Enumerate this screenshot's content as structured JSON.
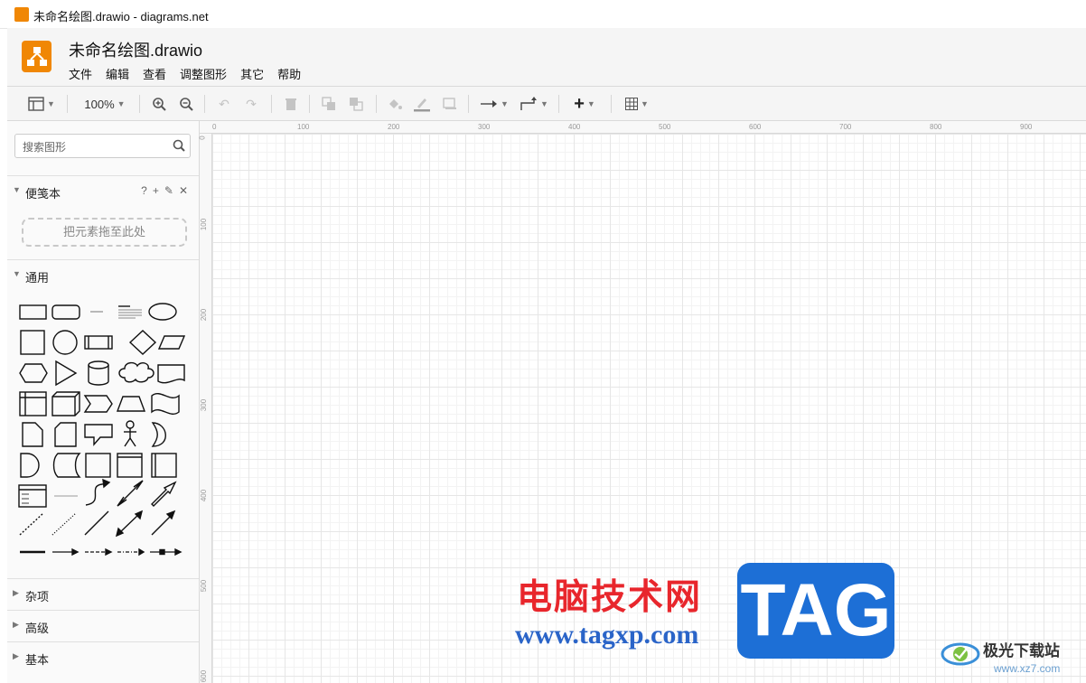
{
  "window": {
    "title": "未命名绘图.drawio - diagrams.net"
  },
  "header": {
    "doc_title": "未命名绘图.drawio",
    "menu": [
      "文件",
      "编辑",
      "查看",
      "调整图形",
      "其它",
      "帮助"
    ]
  },
  "toolbar": {
    "zoom": "100%",
    "icons": [
      "view-format-icon",
      "zoom-in-icon",
      "zoom-out-icon",
      "undo-icon",
      "redo-icon",
      "delete-icon",
      "to-front-icon",
      "to-back-icon",
      "fill-color-icon",
      "line-color-icon",
      "shadow-icon",
      "connection-icon",
      "waypoints-icon",
      "insert-icon",
      "table-icon"
    ]
  },
  "sidebar": {
    "search_placeholder": "搜索图形",
    "scratchpad": {
      "label": "便笺本",
      "tools": [
        "?",
        "+",
        "✎",
        "✕"
      ],
      "dropzone": "把元素拖至此处"
    },
    "general": {
      "label": "通用"
    },
    "sections": [
      "杂项",
      "高级",
      "基本"
    ]
  },
  "rulers": {
    "horizontal": [
      "0",
      "100",
      "200",
      "300",
      "400",
      "500",
      "600",
      "700",
      "800",
      "900"
    ],
    "vertical": [
      "0",
      "100",
      "200",
      "300",
      "400",
      "500",
      "600"
    ]
  },
  "watermark": {
    "cn": "电脑技术网",
    "url": "www.tagxp.com",
    "tag": "TAG",
    "site2": "极光下载站",
    "site2_url": "www.xz7.com"
  },
  "colors": {
    "brand": "#f08705",
    "wm_red": "#e8262c",
    "wm_blue": "#1d6fd6"
  }
}
